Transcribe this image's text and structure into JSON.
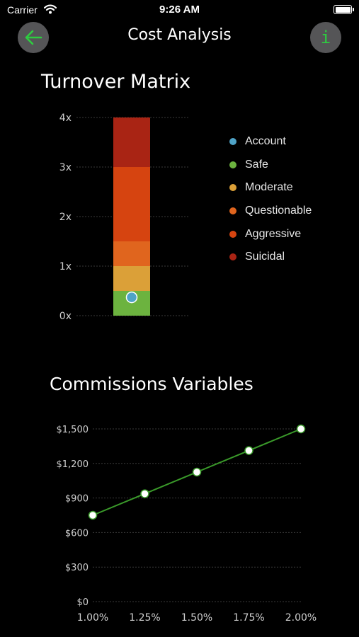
{
  "status_bar": {
    "carrier": "Carrier",
    "time": "9:26 AM"
  },
  "nav": {
    "title": "Cost Analysis",
    "back_icon": "arrow-left-icon",
    "info_icon": "info-icon",
    "info_glyph": "i",
    "accent": "#2ecc40"
  },
  "turnover": {
    "title": "Turnover Matrix",
    "legend": [
      {
        "label": "Account",
        "color": "#4fa3c7"
      },
      {
        "label": "Safe",
        "color": "#6cb33f"
      },
      {
        "label": "Moderate",
        "color": "#dba038"
      },
      {
        "label": "Questionable",
        "color": "#e0651e"
      },
      {
        "label": "Aggressive",
        "color": "#d64410"
      },
      {
        "label": "Suicidal",
        "color": "#a92414"
      }
    ]
  },
  "commissions": {
    "title": "Commissions Variables"
  },
  "chart_data": [
    {
      "type": "bar",
      "title": "Turnover Matrix",
      "stacked": true,
      "ylim": [
        0,
        4
      ],
      "yticks": [
        "0x",
        "1x",
        "2x",
        "3x",
        "4x"
      ],
      "segments": [
        {
          "name": "Safe",
          "from": 0,
          "to": 0.5,
          "color": "#6cb33f"
        },
        {
          "name": "Moderate",
          "from": 0.5,
          "to": 1.0,
          "color": "#dba038"
        },
        {
          "name": "Questionable",
          "from": 1.0,
          "to": 1.5,
          "color": "#e0651e"
        },
        {
          "name": "Aggressive",
          "from": 1.5,
          "to": 3.0,
          "color": "#d64410"
        },
        {
          "name": "Suicidal",
          "from": 3.0,
          "to": 4.0,
          "color": "#a92414"
        }
      ],
      "marker": {
        "name": "Account",
        "value": 0.37,
        "color": "#4fa3c7"
      },
      "grid": true,
      "legend": "right"
    },
    {
      "type": "line",
      "title": "Commissions Variables",
      "x": [
        "1.00%",
        "1.25%",
        "1.50%",
        "1.75%",
        "2.00%"
      ],
      "values": [
        750,
        937,
        1125,
        1312,
        1500
      ],
      "yticks": [
        "$0",
        "$300",
        "$600",
        "$900",
        "$1,200",
        "$1,500"
      ],
      "ylim": [
        0,
        1500
      ],
      "line_color": "#3a9a2a",
      "grid": true
    }
  ]
}
